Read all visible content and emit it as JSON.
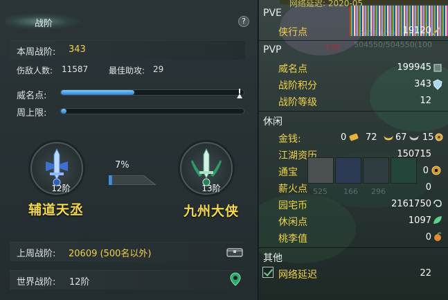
{
  "left": {
    "title": "战阶",
    "help": "?",
    "weekly_rank_label": "本周战阶:",
    "weekly_rank_value": "343",
    "kills_label": "伤敌人数:",
    "kills_value": "11587",
    "assists_label": "最佳助攻:",
    "assists_value": "29",
    "prestige_label": "威名点:",
    "prestige_progress": 0.4,
    "weekly_cap_label": "周上限:",
    "weekly_cap_progress": 0.03,
    "current_rank": "12阶",
    "current_title": "辅道天丞",
    "next_rank": "13阶",
    "next_title": "九州大侠",
    "progress_pct": "7%",
    "progress_value": 0.07,
    "last_week_label": "上周战阶:",
    "last_week_value": "20609 (500名以外)",
    "world_label": "世界战阶:",
    "world_value": "12阶"
  },
  "right": {
    "pve_header": "PVE",
    "xiaxing_label": "侠行点",
    "xiaxing_value": "19120",
    "pvp_header": "PVP",
    "weiming_label": "威名点",
    "weiming_value": "199945",
    "zhanjie_score_label": "战阶积分",
    "zhanjie_score_value": "343",
    "zhanjie_level_label": "战阶等级",
    "zhanjie_level_value": "12",
    "leisure_header": "休闲",
    "money_label": "金钱:",
    "money_gold": "0",
    "money_silver": "72",
    "money_copper": "67",
    "money_other": "15",
    "jianghu_label": "江湖资历",
    "jianghu_value": "150715",
    "tongbao_label": "通宝",
    "tongbao_value": "0",
    "xinhuo_label": "薪火点",
    "xinhuo_value": "0",
    "yuanzhai_label": "园宅币",
    "yuanzhai_value": "2161750",
    "xiuxian_label": "休闲点",
    "xiuxian_value": "1097",
    "taoli_label": "桃李值",
    "taoli_value": "0",
    "other_header": "其他",
    "latency_label": "网络延迟",
    "latency_value": "22",
    "bg_text_1": "296787/29",
    "bg_text_2": "504550/504550(100",
    "bg_text_3": "130",
    "bg_text_4": "525",
    "bg_text_5": "166",
    "bg_text_6": "296",
    "bg_text_7": "网络延迟: 2020-05"
  },
  "colors": {
    "accent_yellow": "#f2d24a",
    "bar_blue": "#2b7fd1",
    "panel_bg": "#263033"
  }
}
